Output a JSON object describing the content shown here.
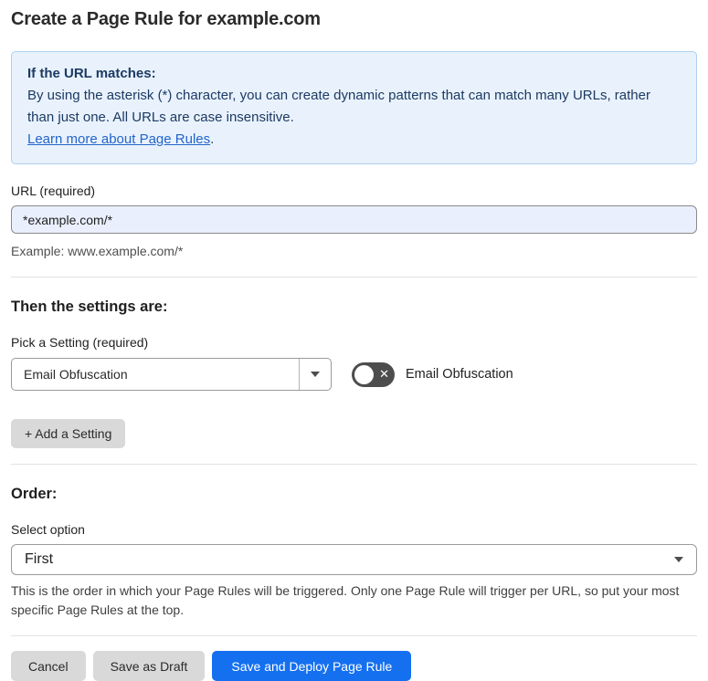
{
  "page": {
    "title": "Create a Page Rule for example.com"
  },
  "info_box": {
    "heading": "If the URL matches:",
    "body": "By using the asterisk (*) character, you can create dynamic patterns that can match many URLs, rather than just one. All URLs are case insensitive.",
    "link_label": "Learn more about Page Rules",
    "link_suffix": "."
  },
  "url_section": {
    "label": "URL (required)",
    "value": "*example.com/*",
    "helper": "Example: www.example.com/*"
  },
  "settings_section": {
    "heading": "Then the settings are:",
    "picker_label": "Pick a Setting (required)",
    "selected_setting": "Email Obfuscation",
    "toggle_label": "Email Obfuscation",
    "toggle_state": "off",
    "add_setting_label": "+ Add a Setting"
  },
  "order_section": {
    "heading": "Order:",
    "select_label": "Select option",
    "selected_value": "First",
    "helper": "This is the order in which your Page Rules will be triggered. Only one Page Rule will trigger per URL, so put your most specific Page Rules at the top."
  },
  "footer": {
    "cancel_label": "Cancel",
    "save_draft_label": "Save as Draft",
    "save_deploy_label": "Save and Deploy Page Rule"
  },
  "colors": {
    "accent_blue": "#1570ef",
    "info_bg": "#e9f2fc",
    "info_border": "#abcfef",
    "info_text": "#1c3a63",
    "link_blue": "#2364cb",
    "input_bg": "#e9effc",
    "button_gray": "#d9d9d9",
    "toggle_off": "#4d4d4d"
  }
}
